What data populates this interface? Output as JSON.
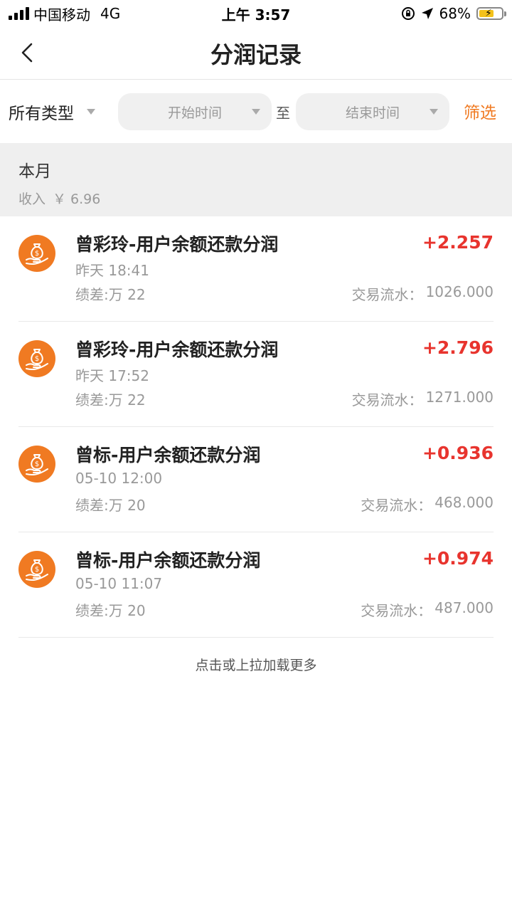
{
  "status_bar": {
    "carrier": "中国移动",
    "network": "4G",
    "time": "上午 3:57",
    "battery": "68%",
    "battery_level": 0.68
  },
  "nav": {
    "title": "分润记录"
  },
  "filters": {
    "type_select": "所有类型",
    "start_placeholder": "开始时间",
    "to_label": "至",
    "end_placeholder": "结束时间",
    "filter_button": "筛选"
  },
  "month": {
    "title": "本月",
    "income_label": "收入",
    "income_value": "￥ 6.96"
  },
  "records": [
    {
      "title": "曾彩玲-用户余额还款分润",
      "time": "昨天 18:41",
      "performance": "绩差:万 22",
      "amount": "+2.257",
      "flow_label": "交易流水：",
      "flow_value": "1026.000"
    },
    {
      "title": "曾彩玲-用户余额还款分润",
      "time": "昨天 17:52",
      "performance": "绩差:万 22",
      "amount": "+2.796",
      "flow_label": "交易流水：",
      "flow_value": "1271.000"
    },
    {
      "title": "曾标-用户余额还款分润",
      "time": "05-10 12:00",
      "performance": "绩差:万 20",
      "amount": "+0.936",
      "flow_label": "交易流水：",
      "flow_value": "468.000"
    },
    {
      "title": "曾标-用户余额还款分润",
      "time": "05-10 11:07",
      "performance": "绩差:万 20",
      "amount": "+0.974",
      "flow_label": "交易流水：",
      "flow_value": "487.000"
    }
  ],
  "load_more": "点击或上拉加载更多",
  "colors": {
    "accent": "#f07a22",
    "amount": "#e8342e",
    "section_bg": "#efefef"
  },
  "icons": {
    "back": "chevron-left-icon",
    "record": "money-bag-hand-icon"
  }
}
